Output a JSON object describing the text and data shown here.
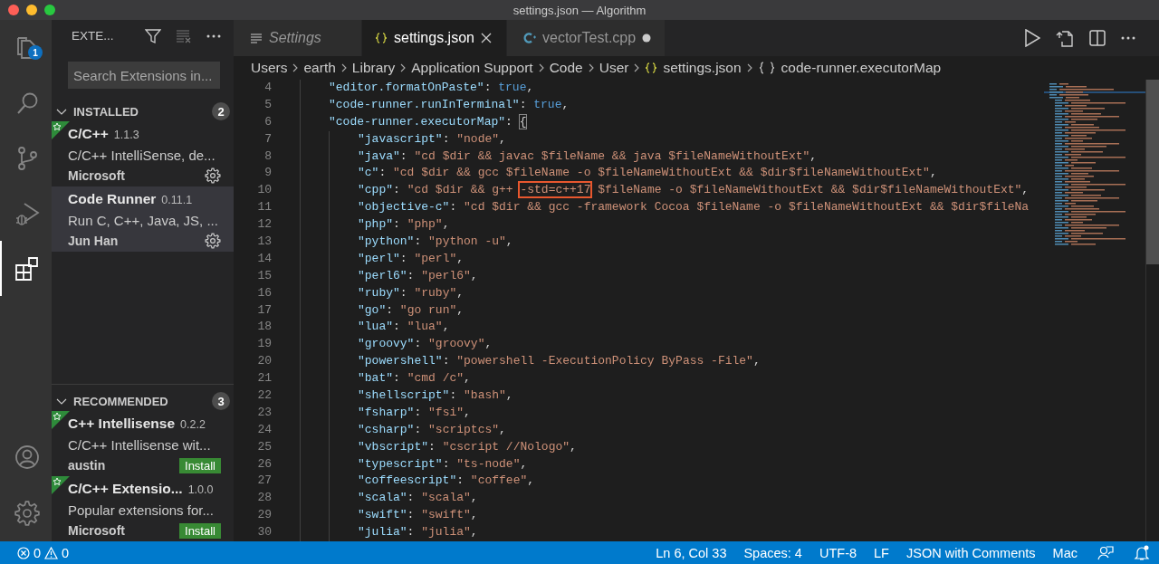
{
  "window": {
    "title": "settings.json — Algorithm"
  },
  "activity_bar": {
    "top_items": [
      {
        "kind": "explorer",
        "selected": false,
        "badge": "1"
      },
      {
        "kind": "search",
        "selected": false
      },
      {
        "kind": "source-control",
        "selected": false
      },
      {
        "kind": "run-debug",
        "selected": false
      },
      {
        "kind": "extensions",
        "selected": true
      }
    ],
    "bottom_items": [
      {
        "kind": "account",
        "selected": false
      },
      {
        "kind": "manage",
        "selected": false
      }
    ]
  },
  "sidebar": {
    "title": "EXTE...",
    "search": {
      "placeholder": "Search Extensions in..."
    },
    "sections": [
      {
        "title": "INSTALLED",
        "count": "2",
        "expanded": true,
        "items": [
          {
            "kind": "installed",
            "name": "C/C++",
            "version": "1.1.3",
            "description": "C/C++ IntelliSense, de...",
            "publisher": "Microsoft",
            "featured": true,
            "selected": false
          },
          {
            "kind": "installed",
            "name": "Code Runner",
            "version": "0.11.1",
            "description": "Run C, C++, Java, JS, ...",
            "publisher": "Jun Han",
            "featured": false,
            "selected": true
          }
        ]
      },
      {
        "title": "RECOMMENDED",
        "count": "3",
        "expanded": true,
        "items": [
          {
            "kind": "recommended",
            "name": "C++ Intellisense",
            "version": "0.2.2",
            "description": "C/C++ Intellisense wit...",
            "publisher": "austin",
            "featured": true,
            "selected": false,
            "action": "Install"
          },
          {
            "kind": "recommended",
            "name": "C/C++ Extensio...",
            "version": "1.0.0",
            "description": "Popular extensions for...",
            "publisher": "Microsoft",
            "featured": true,
            "selected": false,
            "action": "Install"
          }
        ]
      }
    ]
  },
  "editor": {
    "tabs": [
      {
        "label": "Settings",
        "kind": "settings",
        "selected": false,
        "preview": true,
        "modified": false
      },
      {
        "label": "settings.json",
        "kind": "json",
        "selected": true,
        "preview": false,
        "modified": false
      },
      {
        "label": "vectorTest.cpp",
        "kind": "cpp",
        "selected": false,
        "preview": false,
        "modified": true
      }
    ],
    "breadcrumbs": [
      {
        "label": "Users",
        "kind": "folder"
      },
      {
        "label": "earth",
        "kind": "folder"
      },
      {
        "label": "Library",
        "kind": "folder"
      },
      {
        "label": "Application Support",
        "kind": "folder"
      },
      {
        "label": "Code",
        "kind": "folder"
      },
      {
        "label": "User",
        "kind": "folder"
      },
      {
        "label": "settings.json",
        "kind": "json"
      },
      {
        "label": "code-runner.executorMap",
        "kind": "object"
      }
    ],
    "lines": [
      {
        "number": "4",
        "segments": [
          {
            "kind": "key",
            "text": "\"editor.formatOnPaste\""
          },
          {
            "kind": "punct",
            "text": ": "
          },
          {
            "kind": "boolean",
            "text": "true"
          },
          {
            "kind": "punct",
            "text": ","
          }
        ]
      },
      {
        "number": "5",
        "segments": [
          {
            "kind": "key",
            "text": "\"code-runner.runInTerminal\""
          },
          {
            "kind": "punct",
            "text": ": "
          },
          {
            "kind": "boolean",
            "text": "true"
          },
          {
            "kind": "punct",
            "text": ","
          }
        ]
      },
      {
        "number": "6",
        "segments": [
          {
            "kind": "key",
            "text": "\"code-runner.executorMap\""
          },
          {
            "kind": "punct",
            "text": ": "
          },
          {
            "kind": "bracket-match",
            "text": "{"
          }
        ],
        "children": [
          {
            "number": "7",
            "segments": [
              {
                "kind": "key",
                "text": "\"javascript\""
              },
              {
                "kind": "punct",
                "text": ": "
              },
              {
                "kind": "string",
                "text": "\"node\""
              },
              {
                "kind": "punct",
                "text": ","
              }
            ]
          },
          {
            "number": "8",
            "segments": [
              {
                "kind": "key",
                "text": "\"java\""
              },
              {
                "kind": "punct",
                "text": ": "
              },
              {
                "kind": "string",
                "text": "\"cd $dir && javac $fileName && java $fileNameWithoutExt\""
              },
              {
                "kind": "punct",
                "text": ","
              }
            ]
          },
          {
            "number": "9",
            "segments": [
              {
                "kind": "key",
                "text": "\"c\""
              },
              {
                "kind": "punct",
                "text": ": "
              },
              {
                "kind": "string",
                "text": "\"cd $dir && gcc $fileName -o $fileNameWithoutExt && $dir$fileNameWithoutExt\""
              },
              {
                "kind": "punct",
                "text": ","
              }
            ]
          },
          {
            "number": "10",
            "segments": [
              {
                "kind": "key",
                "text": "\"cpp\""
              },
              {
                "kind": "punct",
                "text": ": "
              },
              {
                "kind": "string",
                "text": "\"cd $dir && g++ "
              },
              {
                "kind": "highlight",
                "text": "-std=c++17"
              },
              {
                "kind": "string",
                "text": " $fileName -o $fileNameWithoutExt && $dir$fileNameWithoutExt\""
              },
              {
                "kind": "punct",
                "text": ","
              }
            ]
          },
          {
            "number": "11",
            "segments": [
              {
                "kind": "key",
                "text": "\"objective-c\""
              },
              {
                "kind": "punct",
                "text": ": "
              },
              {
                "kind": "string",
                "text": "\"cd $dir && gcc -framework Cocoa $fileName -o $fileNameWithoutExt && $dir$fileNa"
              }
            ]
          },
          {
            "number": "12",
            "segments": [
              {
                "kind": "key",
                "text": "\"php\""
              },
              {
                "kind": "punct",
                "text": ": "
              },
              {
                "kind": "string",
                "text": "\"php\""
              },
              {
                "kind": "punct",
                "text": ","
              }
            ]
          },
          {
            "number": "13",
            "segments": [
              {
                "kind": "key",
                "text": "\"python\""
              },
              {
                "kind": "punct",
                "text": ": "
              },
              {
                "kind": "string",
                "text": "\"python -u\""
              },
              {
                "kind": "punct",
                "text": ","
              }
            ]
          },
          {
            "number": "14",
            "segments": [
              {
                "kind": "key",
                "text": "\"perl\""
              },
              {
                "kind": "punct",
                "text": ": "
              },
              {
                "kind": "string",
                "text": "\"perl\""
              },
              {
                "kind": "punct",
                "text": ","
              }
            ]
          },
          {
            "number": "15",
            "segments": [
              {
                "kind": "key",
                "text": "\"perl6\""
              },
              {
                "kind": "punct",
                "text": ": "
              },
              {
                "kind": "string",
                "text": "\"perl6\""
              },
              {
                "kind": "punct",
                "text": ","
              }
            ]
          },
          {
            "number": "16",
            "segments": [
              {
                "kind": "key",
                "text": "\"ruby\""
              },
              {
                "kind": "punct",
                "text": ": "
              },
              {
                "kind": "string",
                "text": "\"ruby\""
              },
              {
                "kind": "punct",
                "text": ","
              }
            ]
          },
          {
            "number": "17",
            "segments": [
              {
                "kind": "key",
                "text": "\"go\""
              },
              {
                "kind": "punct",
                "text": ": "
              },
              {
                "kind": "string",
                "text": "\"go run\""
              },
              {
                "kind": "punct",
                "text": ","
              }
            ]
          },
          {
            "number": "18",
            "segments": [
              {
                "kind": "key",
                "text": "\"lua\""
              },
              {
                "kind": "punct",
                "text": ": "
              },
              {
                "kind": "string",
                "text": "\"lua\""
              },
              {
                "kind": "punct",
                "text": ","
              }
            ]
          },
          {
            "number": "19",
            "segments": [
              {
                "kind": "key",
                "text": "\"groovy\""
              },
              {
                "kind": "punct",
                "text": ": "
              },
              {
                "kind": "string",
                "text": "\"groovy\""
              },
              {
                "kind": "punct",
                "text": ","
              }
            ]
          },
          {
            "number": "20",
            "segments": [
              {
                "kind": "key",
                "text": "\"powershell\""
              },
              {
                "kind": "punct",
                "text": ": "
              },
              {
                "kind": "string",
                "text": "\"powershell -ExecutionPolicy ByPass -File\""
              },
              {
                "kind": "punct",
                "text": ","
              }
            ]
          },
          {
            "number": "21",
            "segments": [
              {
                "kind": "key",
                "text": "\"bat\""
              },
              {
                "kind": "punct",
                "text": ": "
              },
              {
                "kind": "string",
                "text": "\"cmd /c\""
              },
              {
                "kind": "punct",
                "text": ","
              }
            ]
          },
          {
            "number": "22",
            "segments": [
              {
                "kind": "key",
                "text": "\"shellscript\""
              },
              {
                "kind": "punct",
                "text": ": "
              },
              {
                "kind": "string",
                "text": "\"bash\""
              },
              {
                "kind": "punct",
                "text": ","
              }
            ]
          },
          {
            "number": "23",
            "segments": [
              {
                "kind": "key",
                "text": "\"fsharp\""
              },
              {
                "kind": "punct",
                "text": ": "
              },
              {
                "kind": "string",
                "text": "\"fsi\""
              },
              {
                "kind": "punct",
                "text": ","
              }
            ]
          },
          {
            "number": "24",
            "segments": [
              {
                "kind": "key",
                "text": "\"csharp\""
              },
              {
                "kind": "punct",
                "text": ": "
              },
              {
                "kind": "string",
                "text": "\"scriptcs\""
              },
              {
                "kind": "punct",
                "text": ","
              }
            ]
          },
          {
            "number": "25",
            "segments": [
              {
                "kind": "key",
                "text": "\"vbscript\""
              },
              {
                "kind": "punct",
                "text": ": "
              },
              {
                "kind": "string",
                "text": "\"cscript //Nologo\""
              },
              {
                "kind": "punct",
                "text": ","
              }
            ]
          },
          {
            "number": "26",
            "segments": [
              {
                "kind": "key",
                "text": "\"typescript\""
              },
              {
                "kind": "punct",
                "text": ": "
              },
              {
                "kind": "string",
                "text": "\"ts-node\""
              },
              {
                "kind": "punct",
                "text": ","
              }
            ]
          },
          {
            "number": "27",
            "segments": [
              {
                "kind": "key",
                "text": "\"coffeescript\""
              },
              {
                "kind": "punct",
                "text": ": "
              },
              {
                "kind": "string",
                "text": "\"coffee\""
              },
              {
                "kind": "punct",
                "text": ","
              }
            ]
          },
          {
            "number": "28",
            "segments": [
              {
                "kind": "key",
                "text": "\"scala\""
              },
              {
                "kind": "punct",
                "text": ": "
              },
              {
                "kind": "string",
                "text": "\"scala\""
              },
              {
                "kind": "punct",
                "text": ","
              }
            ]
          },
          {
            "number": "29",
            "segments": [
              {
                "kind": "key",
                "text": "\"swift\""
              },
              {
                "kind": "punct",
                "text": ": "
              },
              {
                "kind": "string",
                "text": "\"swift\""
              },
              {
                "kind": "punct",
                "text": ","
              }
            ]
          },
          {
            "number": "30",
            "segments": [
              {
                "kind": "key",
                "text": "\"julia\""
              },
              {
                "kind": "punct",
                "text": ": "
              },
              {
                "kind": "string",
                "text": "\"julia\""
              },
              {
                "kind": "punct",
                "text": ","
              }
            ]
          }
        ]
      }
    ]
  },
  "status_bar": {
    "errors": "0",
    "warnings": "0",
    "items": [
      "Ln 6, Col 33",
      "Spaces: 4",
      "UTF-8",
      "LF",
      "JSON with Comments",
      "Mac"
    ]
  }
}
